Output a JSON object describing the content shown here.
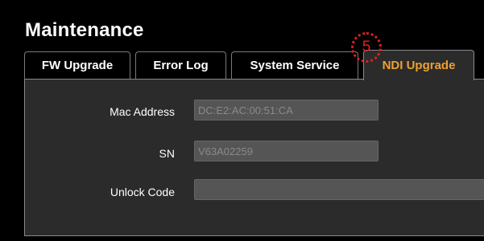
{
  "page": {
    "title": "Maintenance"
  },
  "tabs": [
    {
      "label": "FW Upgrade",
      "active": false
    },
    {
      "label": "Error Log",
      "active": false
    },
    {
      "label": "System Service",
      "active": false
    },
    {
      "label": "NDI Upgrade",
      "active": true
    }
  ],
  "annotation": {
    "step_number": "5"
  },
  "form": {
    "mac_address": {
      "label": "Mac Address",
      "value": "DC:E2:AC:00:51:CA"
    },
    "sn": {
      "label": "SN",
      "value": "V63A02259"
    },
    "unlock_code": {
      "label": "Unlock Code",
      "value": ""
    }
  },
  "colors": {
    "background": "#000000",
    "panel": "#2b2b2b",
    "active_tab_text": "#f0a030",
    "annotation": "#e0201e",
    "input_bg": "#555555"
  }
}
